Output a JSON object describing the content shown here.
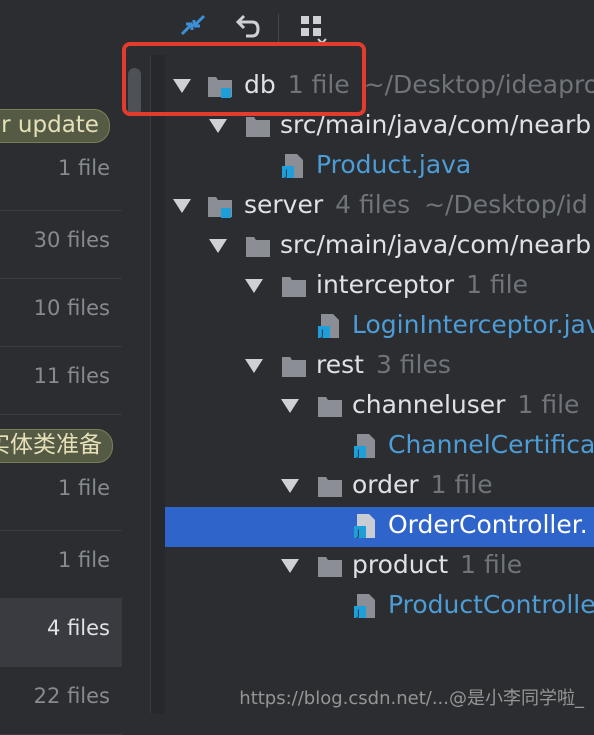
{
  "toolbar": {
    "icons": [
      "collapse-all-icon",
      "undo-icon",
      "group-by-icon"
    ]
  },
  "left_panel": {
    "badges": [
      {
        "text": "er update"
      },
      {
        "text": "实体类准备"
      }
    ],
    "rows": [
      {
        "count": "1 file"
      },
      {
        "count": "30 files"
      },
      {
        "count": "10 files"
      },
      {
        "count": "11 files"
      },
      {
        "count": "1 file"
      },
      {
        "count": "1 file"
      },
      {
        "count": "4 files"
      },
      {
        "count": "22 files"
      }
    ]
  },
  "tree": {
    "db": {
      "name": "db",
      "meta": "1 file",
      "path": "~/Desktop/ideapro"
    },
    "db_src": {
      "name": "src/main/java/com/nearb"
    },
    "product_java": {
      "name": "Product.java"
    },
    "server": {
      "name": "server",
      "meta": "4 files",
      "path": "~/Desktop/id"
    },
    "server_src": {
      "name": "src/main/java/com/nearb"
    },
    "interceptor": {
      "name": "interceptor",
      "meta": "1 file"
    },
    "login_interceptor": {
      "name": "LoginInterceptor.jav"
    },
    "rest": {
      "name": "rest",
      "meta": "3 files"
    },
    "channeluser": {
      "name": "channeluser",
      "meta": "1 file"
    },
    "channel_cert": {
      "name": "ChannelCertifica"
    },
    "order": {
      "name": "order",
      "meta": "1 file"
    },
    "order_controller": {
      "name": "OrderController."
    },
    "product": {
      "name": "product",
      "meta": "1 file"
    },
    "product_controller": {
      "name": "ProductControlle"
    }
  },
  "watermark": "https://blog.csdn.net/...@是小李同学啦_",
  "colors": {
    "selection": "#2f65ca",
    "highlight_box": "#e23c2f",
    "java_file": "#4d9cd6",
    "module_badge": "#1e9fd9"
  }
}
